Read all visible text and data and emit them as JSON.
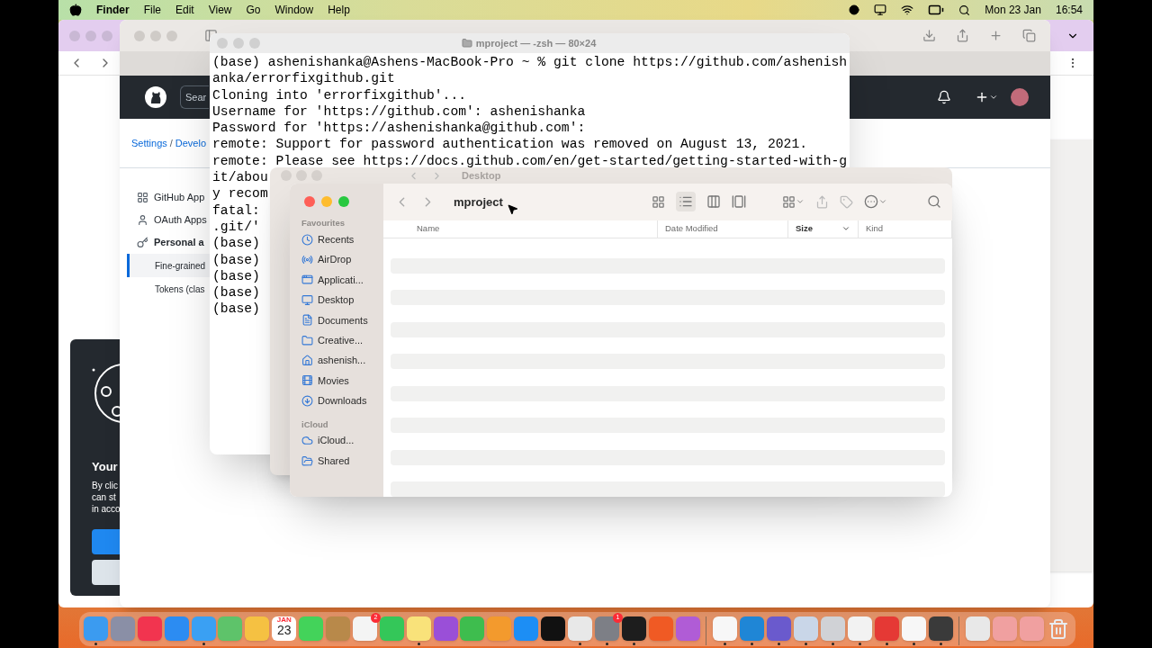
{
  "menu_bar": {
    "app": "Finder",
    "menus": [
      "File",
      "Edit",
      "View",
      "Go",
      "Window",
      "Help"
    ],
    "date": "Mon 23 Jan",
    "time": "16:54"
  },
  "browser": {
    "github": {
      "search_placeholder": "Sear",
      "breadcrumb": [
        "Settings",
        "Develo"
      ],
      "breadcrumb_separator": "/",
      "sidebar": [
        {
          "label": "GitHub App",
          "kind": "apps",
          "selected": false
        },
        {
          "label": "OAuth Apps",
          "kind": "person",
          "selected": false
        },
        {
          "label": "Personal a",
          "kind": "key",
          "selected": true,
          "children": [
            {
              "label": "Fine-grained",
              "selected": true
            },
            {
              "label": "Tokens (clas",
              "selected": false
            }
          ]
        }
      ]
    },
    "cookie_panel": {
      "title": "Your",
      "lines": [
        "By clic",
        "can st",
        "in acco"
      ]
    }
  },
  "terminal": {
    "title": "mproject — -zsh — 80×24",
    "lines": [
      "(base) ashenishanka@Ashens-MacBook-Pro ~ % git clone https://github.com/ashenish",
      "anka/errorfixgithub.git",
      "Cloning into 'errorfixgithub'...",
      "Username for 'https://github.com': ashenishanka",
      "Password for 'https://ashenishanka@github.com':",
      "remote: Support for password authentication was removed on August 13, 2021.",
      "remote: Please see https://docs.github.com/en/get-started/getting-started-with-g",
      "it/abou",
      "y recom",
      "fatal:",
      ".git/'",
      "(base)",
      "(base)",
      "(base)",
      "(base)",
      "(base)"
    ]
  },
  "finder_back": {
    "title": "Desktop"
  },
  "finder": {
    "title": "mproject",
    "sections": [
      {
        "heading": "Favourites",
        "items": [
          {
            "label": "Recents",
            "kind": "clock"
          },
          {
            "label": "AirDrop",
            "kind": "airdrop"
          },
          {
            "label": "Applicati...",
            "kind": "apps"
          },
          {
            "label": "Desktop",
            "kind": "desktop"
          },
          {
            "label": "Documents",
            "kind": "document"
          },
          {
            "label": "Creative...",
            "kind": "folder"
          },
          {
            "label": "ashenish...",
            "kind": "home"
          },
          {
            "label": "Movies",
            "kind": "film"
          },
          {
            "label": "Downloads",
            "kind": "download"
          }
        ]
      },
      {
        "heading": "iCloud",
        "items": [
          {
            "label": "iCloud...",
            "kind": "cloud"
          },
          {
            "label": "Shared",
            "kind": "shared"
          }
        ]
      }
    ],
    "columns": [
      {
        "label": "Name",
        "sorted": false
      },
      {
        "label": "Date Modified",
        "sorted": false
      },
      {
        "label": "Size",
        "sorted": true
      },
      {
        "label": "Kind",
        "sorted": false
      }
    ]
  },
  "dock": {
    "calendar": {
      "month": "JAN",
      "day": "23"
    },
    "groups": [
      {
        "apps": [
          {
            "kind": "finder",
            "running": true
          },
          {
            "kind": "launchpad",
            "running": false
          },
          {
            "kind": "music",
            "running": false
          },
          {
            "kind": "mail",
            "running": false
          },
          {
            "kind": "safari",
            "running": true
          },
          {
            "kind": "maps",
            "running": false
          },
          {
            "kind": "photos",
            "running": false
          },
          {
            "kind": "calendar",
            "running": false
          },
          {
            "kind": "messages",
            "running": false
          },
          {
            "kind": "books",
            "running": false
          },
          {
            "kind": "reminders",
            "running": false,
            "badge": "2"
          },
          {
            "kind": "facetime",
            "running": false
          },
          {
            "kind": "notes",
            "running": true
          },
          {
            "kind": "podcasts",
            "running": false
          },
          {
            "kind": "numbers",
            "running": false
          },
          {
            "kind": "pages",
            "running": false
          },
          {
            "kind": "appstore",
            "running": false
          },
          {
            "kind": "tv",
            "running": false
          },
          {
            "kind": "chrome",
            "running": true
          },
          {
            "kind": "settings",
            "running": true,
            "badge": "1"
          },
          {
            "kind": "terminal",
            "running": true
          },
          {
            "kind": "brave",
            "running": false
          },
          {
            "kind": "feedback",
            "running": false
          }
        ]
      },
      {
        "apps": [
          {
            "kind": "vlc",
            "running": true
          },
          {
            "kind": "vscode",
            "running": true
          },
          {
            "kind": "winrar",
            "running": true
          },
          {
            "kind": "preview",
            "running": true
          },
          {
            "kind": "sysprefs",
            "running": true
          },
          {
            "kind": "textedit",
            "running": true
          },
          {
            "kind": "anydesk",
            "running": true
          },
          {
            "kind": "ide",
            "running": true
          },
          {
            "kind": "screenrec",
            "running": true
          }
        ]
      },
      {
        "apps": [
          {
            "kind": "zip",
            "running": false
          },
          {
            "kind": "unknown",
            "running": false
          },
          {
            "kind": "unknown",
            "running": false
          },
          {
            "kind": "trash",
            "running": false
          }
        ]
      }
    ]
  }
}
